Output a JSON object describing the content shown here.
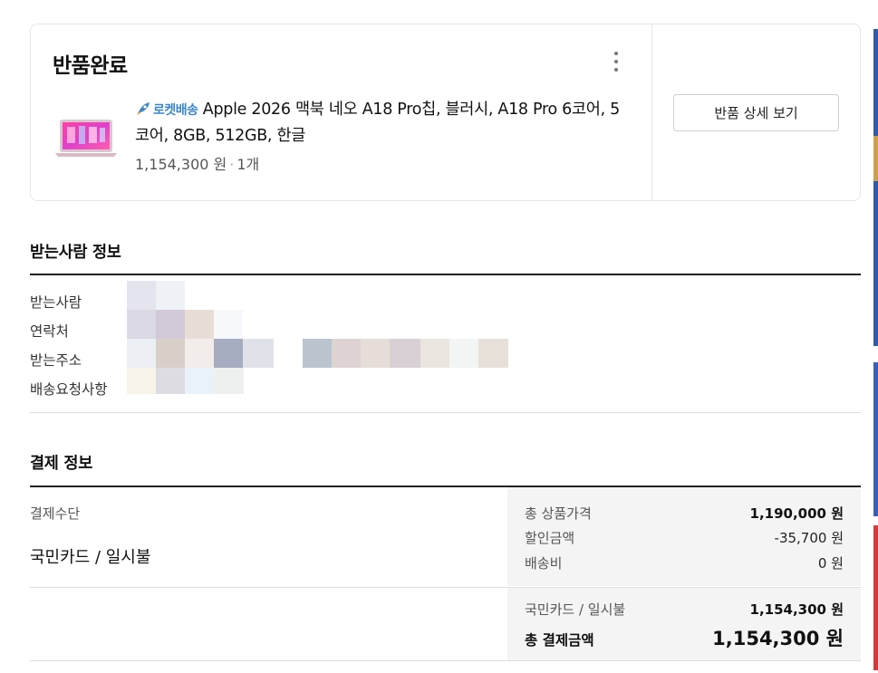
{
  "order": {
    "status_title": "반품완료",
    "product": {
      "badge": "로켓배송",
      "name": "Apple 2026 맥북 네오 A18 Pro칩, 블러시, A18 Pro 6코어, 5코어, 8GB, 512GB, 한글",
      "price": "1,154,300 원",
      "quantity": "1개"
    },
    "detail_button_label": "반품 상세 보기"
  },
  "recipient": {
    "section_title": "받는사람 정보",
    "labels": [
      "받는사람",
      "연락처",
      "받는주소",
      "배송요청사항"
    ]
  },
  "payment": {
    "section_title": "결제 정보",
    "method_label": "결제수단",
    "method_value": "국민카드 / 일시불",
    "summary": {
      "items_total_label": "총 상품가격",
      "items_total_value": "1,190,000 원",
      "discount_label": "할인금액",
      "discount_value": "-35,700 원",
      "shipping_label": "배송비",
      "shipping_value": "0 원",
      "card_label": "국민카드 / 일시불",
      "card_value": "1,154,300 원",
      "grand_total_label": "총 결제금액",
      "grand_total_value": "1,154,300 원"
    }
  },
  "colors": {
    "rocket_blue": "#3d86c6",
    "summary_bg": "#f4f4f4",
    "border": "#e6e6e6"
  }
}
